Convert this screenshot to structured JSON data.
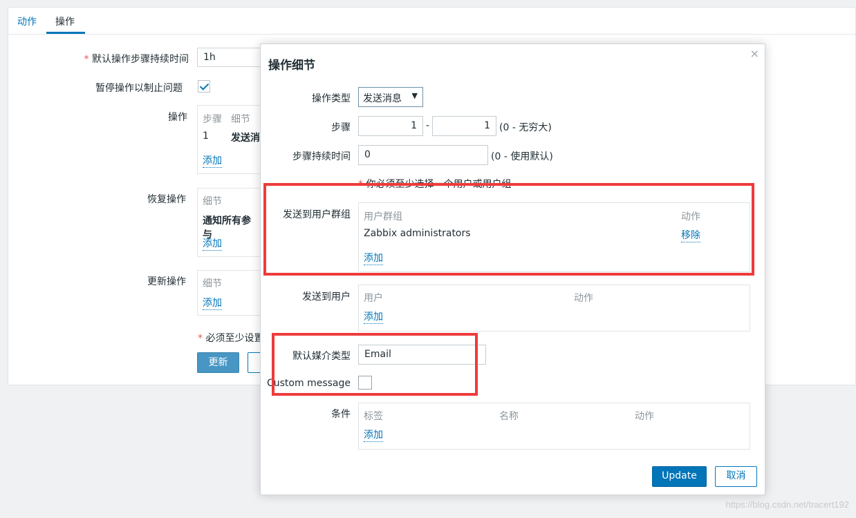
{
  "tabs": {
    "action": "动作",
    "operations": "操作"
  },
  "background": {
    "default_duration_label": "默认操作步骤持续时间",
    "default_duration_value": "1h",
    "pause_label": "暂停操作以制止问题",
    "operations_label": "操作",
    "operations_head_steps": "步骤",
    "operations_head_details": "细节",
    "operations_row_step": "1",
    "operations_row_detail": "发送消",
    "recovery_label": "恢复操作",
    "recovery_head": "细节",
    "recovery_row": "通知所有参与",
    "update_label": "更新操作",
    "update_head": "细节",
    "add": "添加",
    "required_note": "必须至少设置",
    "update_button": "更新"
  },
  "modal": {
    "title": "操作细节",
    "close": "×",
    "op_type_label": "操作类型",
    "op_type_value": "发送消息",
    "steps_label": "步骤",
    "step_from": "1",
    "step_to": "1",
    "steps_hint": "(0 - 无穷大)",
    "step_duration_label": "步骤持续时间",
    "step_duration_value": "0",
    "step_duration_hint": "(0 - 使用默认)",
    "warning": "你必须至少选择一个用户或用户组",
    "send_to_groups_label": "发送到用户群组",
    "groups_col_group": "用户群组",
    "groups_col_action": "动作",
    "group_row_name": "Zabbix administrators",
    "group_row_remove": "移除",
    "groups_add": "添加",
    "send_to_users_label": "发送到用户",
    "users_col_user": "用户",
    "users_col_action": "动作",
    "users_add": "添加",
    "default_media_label": "默认媒介类型",
    "default_media_value": "Email",
    "custom_message_label": "Custom message",
    "conditions_label": "条件",
    "cond_col_label": "标签",
    "cond_col_name": "名称",
    "cond_col_action": "动作",
    "cond_add": "添加",
    "update_button": "Update",
    "cancel_button": "取消"
  },
  "watermark": "https://blog.csdn.net/tracert192",
  "colors": {
    "accent": "#0275b8",
    "highlight_frame": "#ee3b3b"
  }
}
